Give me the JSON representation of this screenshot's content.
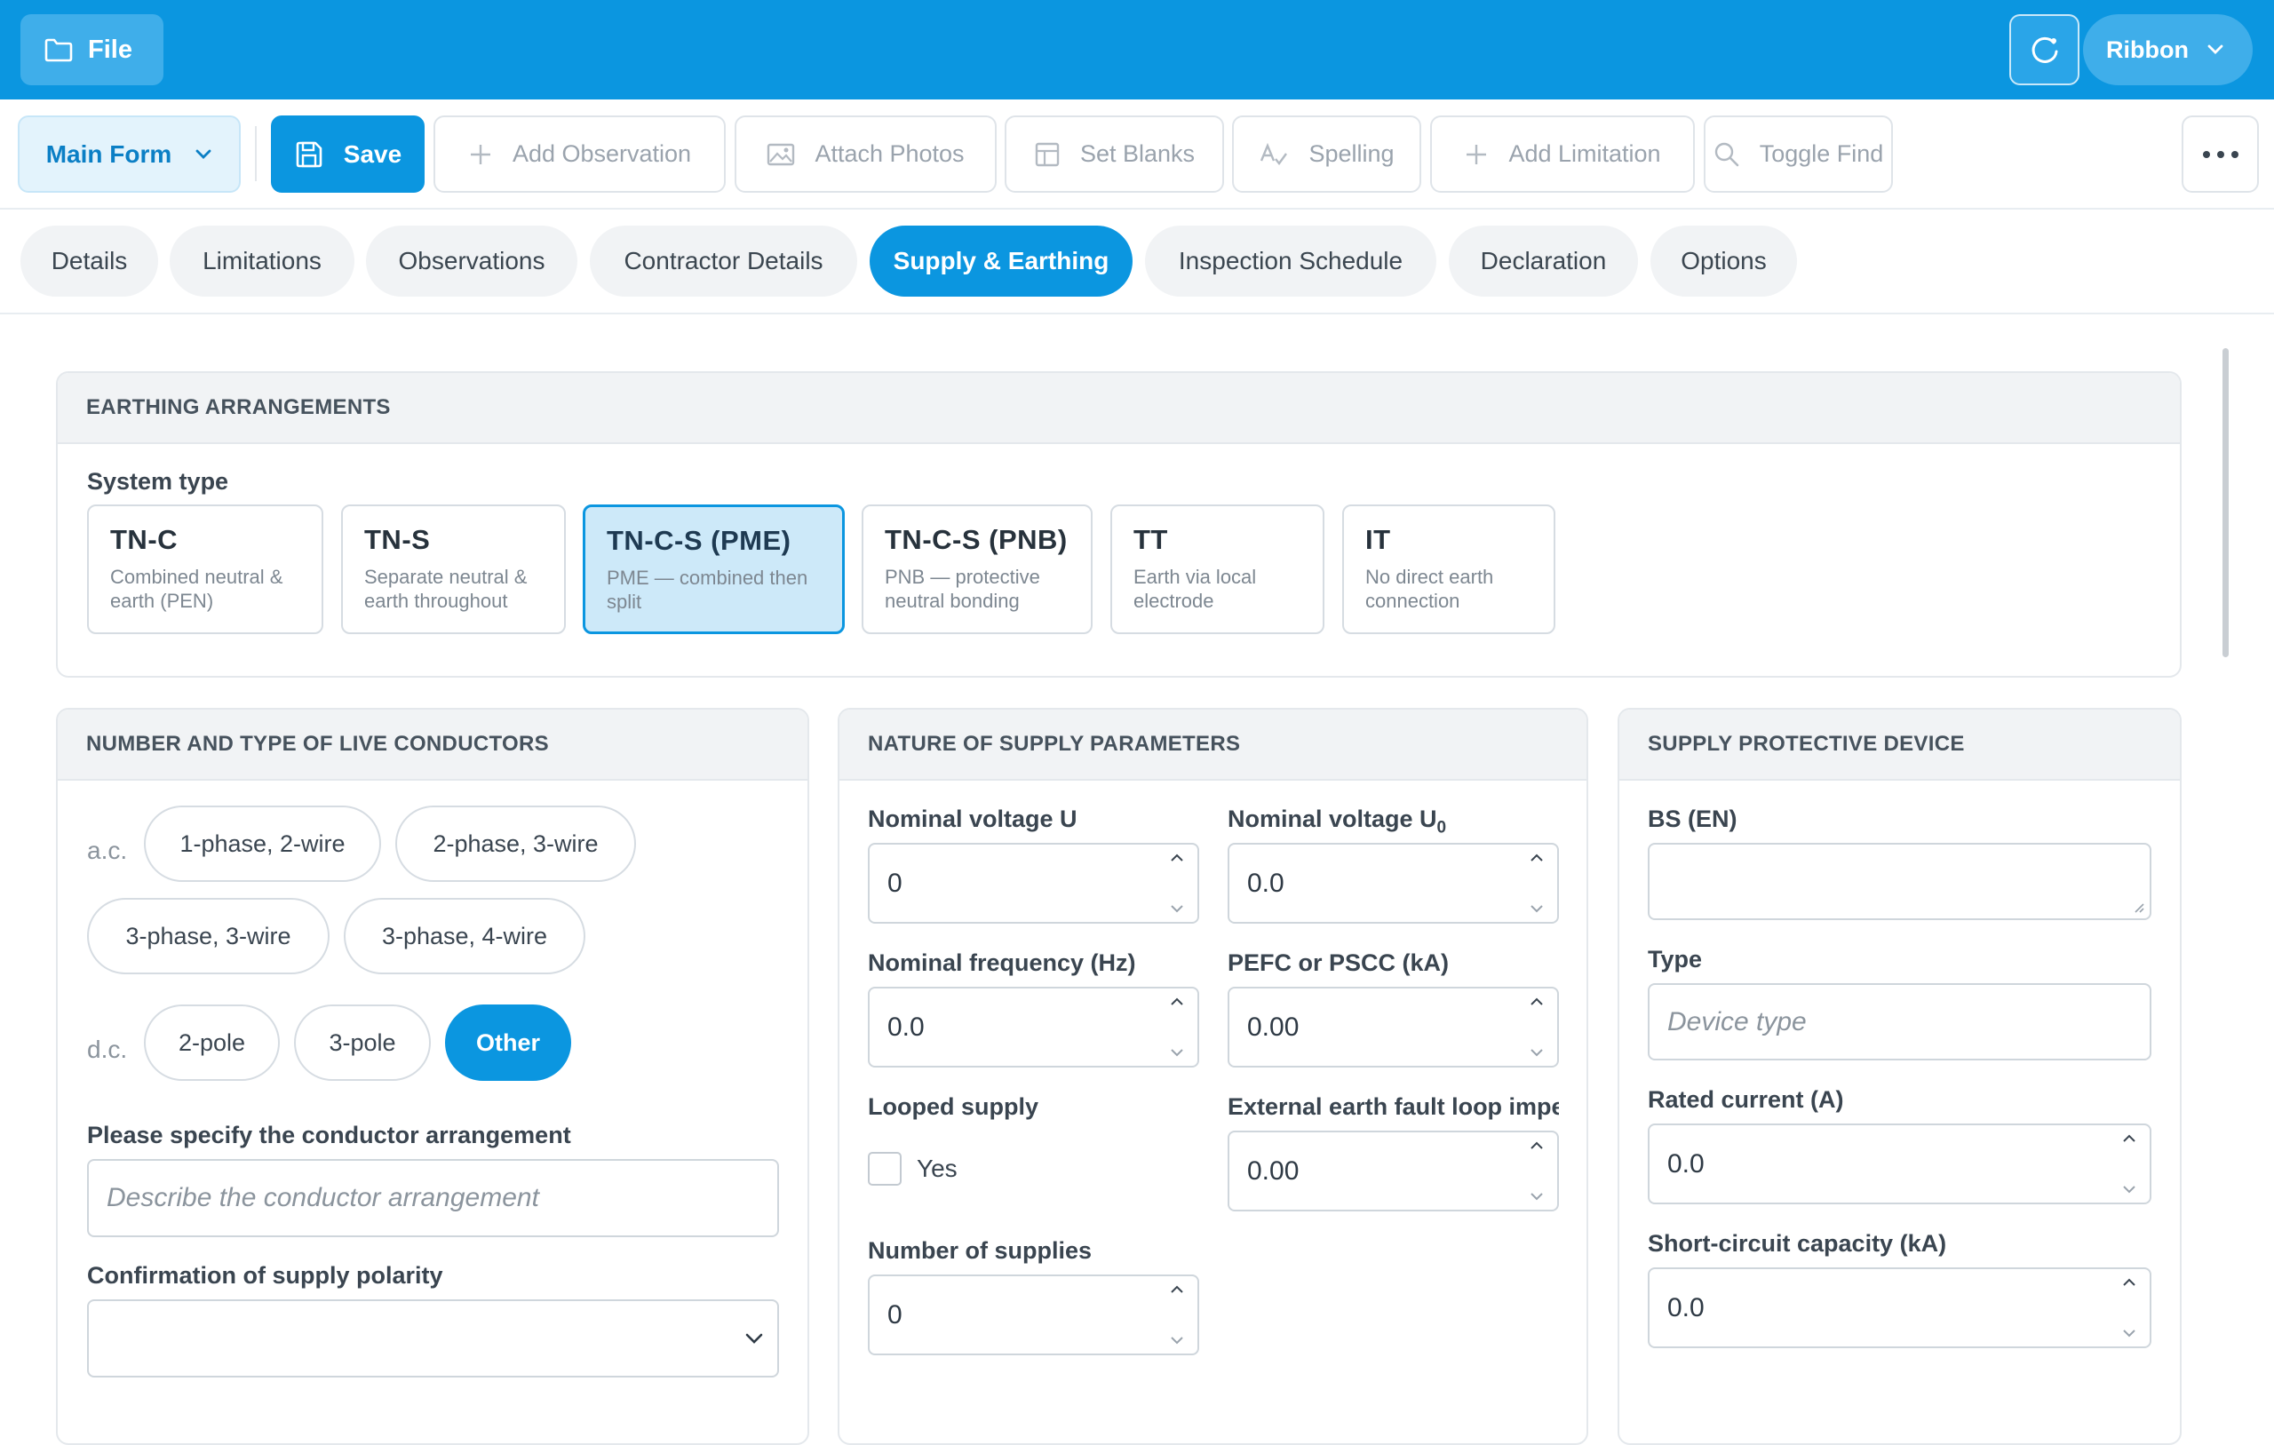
{
  "app": {
    "file_label": "File",
    "ribbon_label": "Ribbon"
  },
  "toolbar": {
    "form_selector": "Main Form",
    "save": "Save",
    "add_observation": "Add Observation",
    "attach_photos": "Attach Photos",
    "set_blanks": "Set Blanks",
    "spelling": "Spelling",
    "add_limitation": "Add Limitation",
    "toggle_find": "Toggle Find"
  },
  "tabs": [
    {
      "label": "Details",
      "active": false
    },
    {
      "label": "Limitations",
      "active": false
    },
    {
      "label": "Observations",
      "active": false
    },
    {
      "label": "Contractor Details",
      "active": false
    },
    {
      "label": "Supply & Earthing",
      "active": true
    },
    {
      "label": "Inspection Schedule",
      "active": false
    },
    {
      "label": "Declaration",
      "active": false
    },
    {
      "label": "Options",
      "active": false
    }
  ],
  "earthing": {
    "heading": "EARTHING ARRANGEMENTS",
    "system_type_label": "System type",
    "options": [
      {
        "title": "TN-C",
        "desc": "Combined neutral & earth (PEN)",
        "selected": false
      },
      {
        "title": "TN-S",
        "desc": "Separate neutral & earth throughout",
        "selected": false
      },
      {
        "title": "TN-C-S (PME)",
        "desc": "PME — combined then split",
        "selected": true
      },
      {
        "title": "TN-C-S (PNB)",
        "desc": "PNB — protective neutral bonding",
        "selected": false
      },
      {
        "title": "TT",
        "desc": "Earth via local electrode",
        "selected": false
      },
      {
        "title": "IT",
        "desc": "No direct earth connection",
        "selected": false
      }
    ]
  },
  "conductors": {
    "heading": "NUMBER AND TYPE OF LIVE CONDUCTORS",
    "ac_label": "a.c.",
    "dc_label": "d.c.",
    "ac_options": [
      {
        "label": "1-phase, 2-wire",
        "selected": false
      },
      {
        "label": "2-phase, 3-wire",
        "selected": false
      },
      {
        "label": "3-phase, 3-wire",
        "selected": false
      },
      {
        "label": "3-phase, 4-wire",
        "selected": false
      }
    ],
    "dc_options": [
      {
        "label": "2-pole",
        "selected": false
      },
      {
        "label": "3-pole",
        "selected": false
      },
      {
        "label": "Other",
        "selected": true
      }
    ],
    "specify_label": "Please specify the conductor arrangement",
    "specify_placeholder": "Describe the conductor arrangement",
    "polarity_label": "Confirmation of supply polarity",
    "polarity_value": ""
  },
  "supply": {
    "heading": "NATURE OF SUPPLY PARAMETERS",
    "nominal_u_label": "Nominal voltage U",
    "nominal_u_value": "0",
    "nominal_u0_label": "Nominal voltage U",
    "nominal_u0_sub": "0",
    "nominal_u0_value": "0.0",
    "frequency_label": "Nominal frequency (Hz)",
    "frequency_value": "0.0",
    "pefc_label": "PEFC or PSCC (kA)",
    "pefc_value": "0.00",
    "looped_label": "Looped supply",
    "looped_option": "Yes",
    "looped_checked": false,
    "ze_label": "External earth fault loop impedance",
    "ze_value": "0.00",
    "num_supplies_label": "Number of supplies",
    "num_supplies_value": "0"
  },
  "device": {
    "heading": "SUPPLY PROTECTIVE DEVICE",
    "bs_label": "BS (EN)",
    "bs_value": "",
    "type_label": "Type",
    "type_placeholder": "Device type",
    "rated_label": "Rated current (A)",
    "rated_value": "0.0",
    "short_label": "Short-circuit capacity (kA)",
    "short_value": "0.0"
  },
  "colors": {
    "brand": "#0b96e0",
    "selected_card_bg": "#cde9f9"
  }
}
